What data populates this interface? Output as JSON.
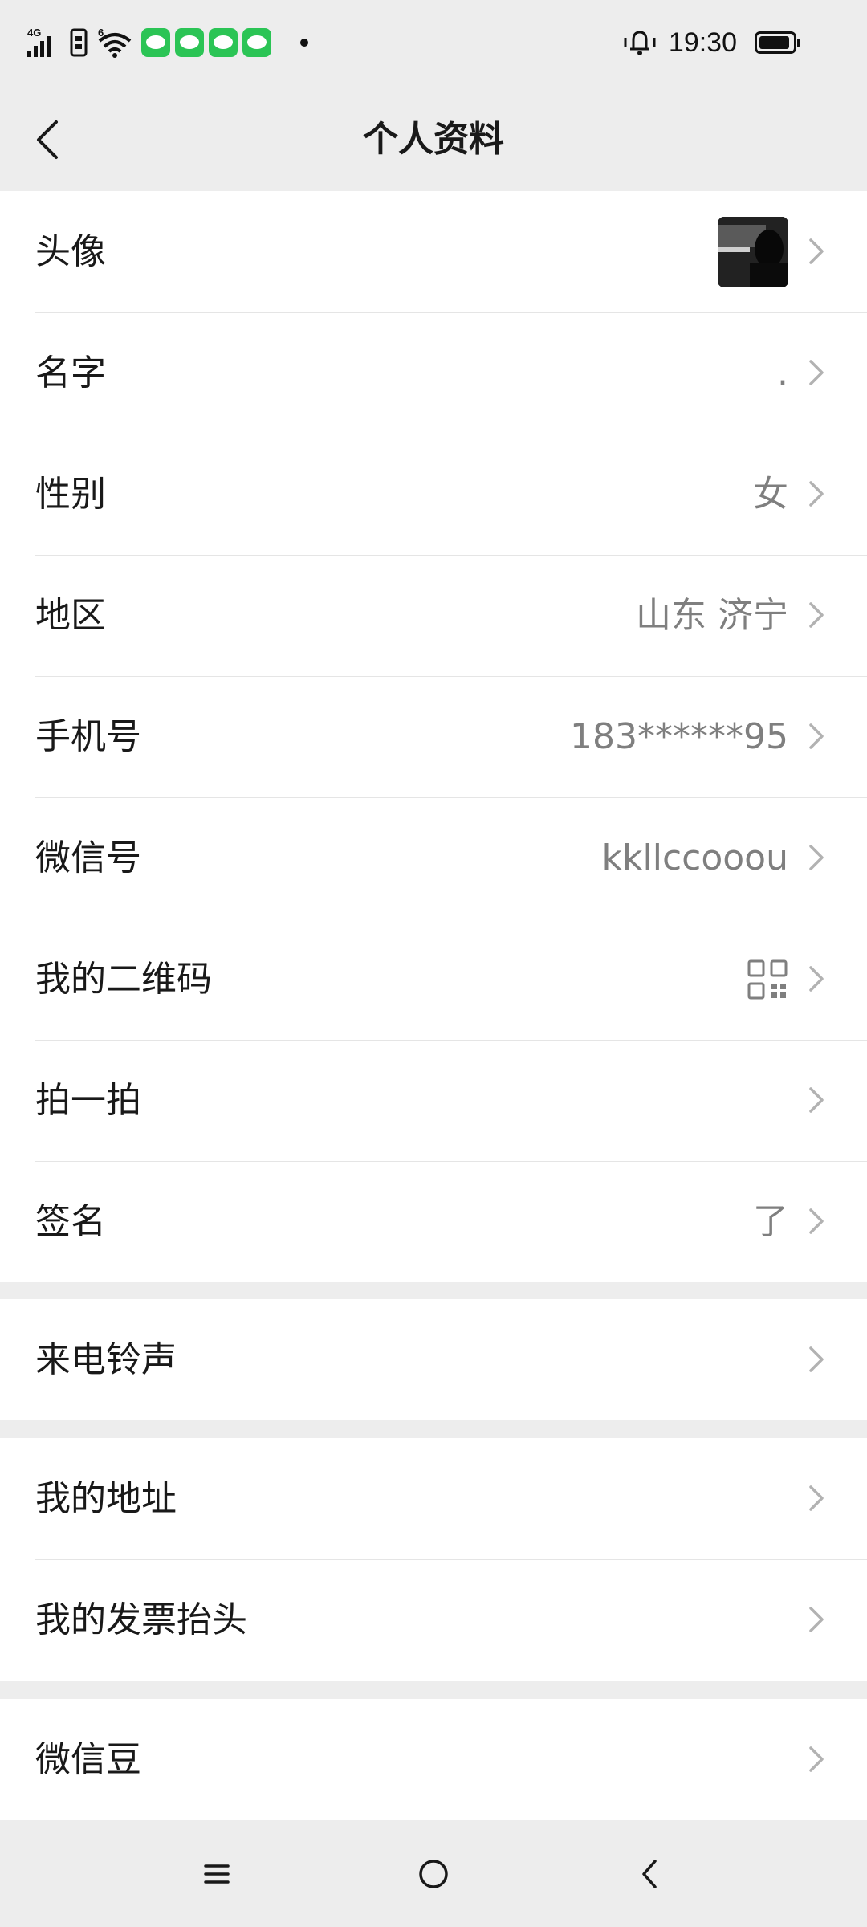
{
  "status_bar": {
    "network_label": "4G",
    "wifi_label": "6",
    "time": "19:30",
    "chat_notification_count": 4
  },
  "nav": {
    "title": "个人资料"
  },
  "profile_rows": [
    {
      "label": "头像",
      "value": "",
      "kind": "avatar"
    },
    {
      "label": "名字",
      "value": "."
    },
    {
      "label": "性别",
      "value": "女"
    },
    {
      "label": "地区",
      "value": "山东 济宁"
    },
    {
      "label": "手机号",
      "value": "183******95"
    },
    {
      "label": "微信号",
      "value": "kkllccooou"
    },
    {
      "label": "我的二维码",
      "value": "",
      "kind": "qr"
    },
    {
      "label": "拍一拍",
      "value": ""
    },
    {
      "label": "签名",
      "value": "了"
    }
  ],
  "ringtone_rows": [
    {
      "label": "来电铃声"
    }
  ],
  "address_rows": [
    {
      "label": "我的地址"
    },
    {
      "label": "我的发票抬头"
    }
  ],
  "beans_rows": [
    {
      "label": "微信豆"
    }
  ],
  "colors": {
    "background": "#ededed",
    "card": "#ffffff",
    "text_primary": "#191919",
    "text_secondary": "#7f7f7f",
    "chat_green": "#2bc455"
  },
  "icons": {
    "back": "chevron-left-icon",
    "row_arrow": "chevron-right-icon",
    "qr": "qr-code-icon",
    "menu": "menu-icon",
    "home": "home-circle-icon",
    "sys_back": "back-icon"
  }
}
